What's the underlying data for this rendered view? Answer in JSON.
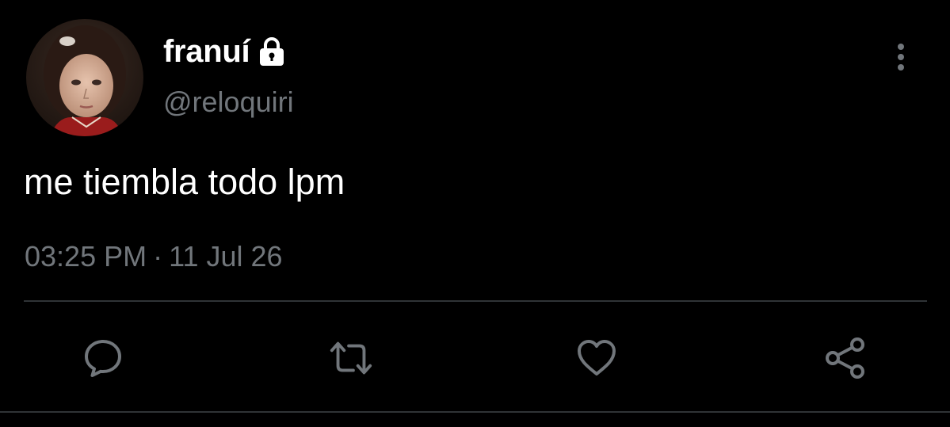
{
  "user": {
    "display_name": "franuí",
    "handle": "@reloquiri",
    "protected_icon": "lock-icon",
    "avatar": "profile-photo"
  },
  "tweet": {
    "text": "me tiembla todo lpm",
    "time": "03:25 PM",
    "separator": "·",
    "date": "11 Jul 26"
  },
  "actions": [
    {
      "name": "reply",
      "icon": "comment-bubble-icon"
    },
    {
      "name": "retweet",
      "icon": "retweet-icon"
    },
    {
      "name": "like",
      "icon": "heart-icon"
    },
    {
      "name": "share",
      "icon": "share-icon"
    }
  ],
  "menu_icon": "more-vertical-icon",
  "colors": {
    "background": "#000000",
    "primary_text": "#ffffff",
    "secondary_text": "#71767b",
    "divider": "#2f3336"
  }
}
